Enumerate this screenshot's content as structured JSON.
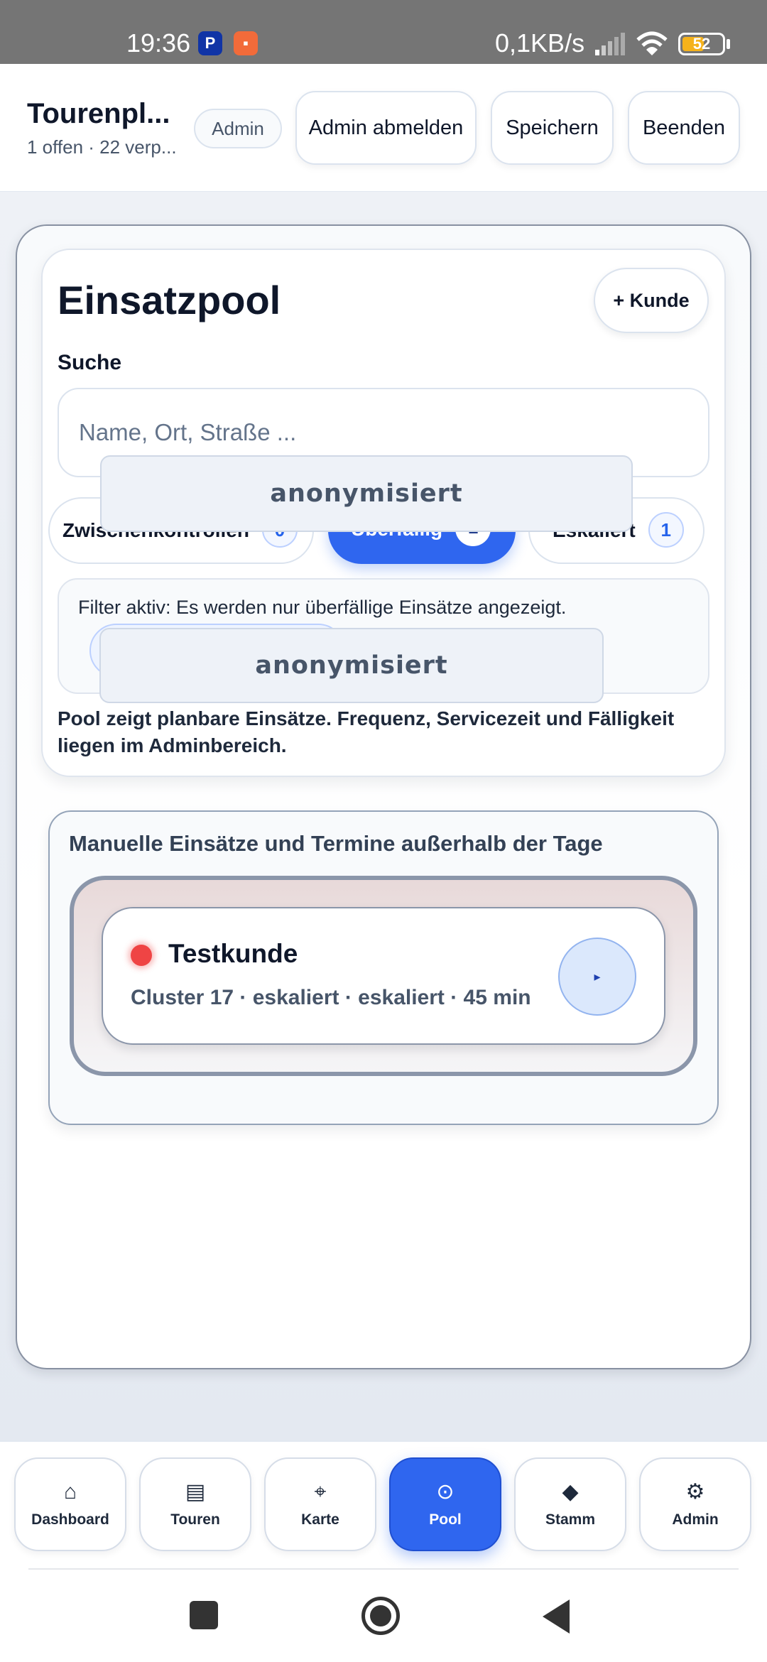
{
  "status_bar": {
    "time": "19:36",
    "speed": "0,1KB/s",
    "battery": "52",
    "app_icons": [
      "paypal-icon",
      "recorder-icon"
    ]
  },
  "header": {
    "title": "Tourenpl...",
    "subtitle": "1 offen · 22 verp...",
    "badge": "Admin",
    "buttons": {
      "logout": "Admin abmelden",
      "save": "Speichern",
      "quit": "Beenden"
    }
  },
  "pool": {
    "title": "Einsatzpool",
    "add_customer": "+ Kunde",
    "search_label": "Suche",
    "search_placeholder": "Name, Ort, Straße ...",
    "chips": [
      {
        "label": "Zwischenkontrollen",
        "count": "0"
      },
      {
        "label": "Überfällig",
        "count": "1"
      },
      {
        "label": "Eskaliert",
        "count": "1"
      }
    ],
    "anonymized": [
      "anonymisiert",
      "anonymisiert"
    ],
    "filter_text": "Filter aktiv: Es werden nur überfällige Einsätze angezeigt.",
    "info": "Pool zeigt planbare Einsätze. Frequenz, Servicezeit und Fälligkeit liegen im Adminbereich."
  },
  "manual": {
    "title": "Manuelle Einsätze und Termine außerhalb der Tage",
    "task": {
      "name": "Testkunde",
      "meta": "Cluster 17 · eskaliert · eskaliert · 45 min",
      "status_color": "#ef4444",
      "play_icon": "▸"
    }
  },
  "nav": [
    {
      "label": "Dashboard",
      "icon": "⌂"
    },
    {
      "label": "Touren",
      "icon": "▤"
    },
    {
      "label": "Karte",
      "icon": "⌖"
    },
    {
      "label": "Pool",
      "icon": "⊙"
    },
    {
      "label": "Stamm",
      "icon": "◆"
    },
    {
      "label": "Admin",
      "icon": "⚙"
    }
  ],
  "colors": {
    "accent": "#2f66ef",
    "text": "#0f172a",
    "muted": "#475569"
  }
}
